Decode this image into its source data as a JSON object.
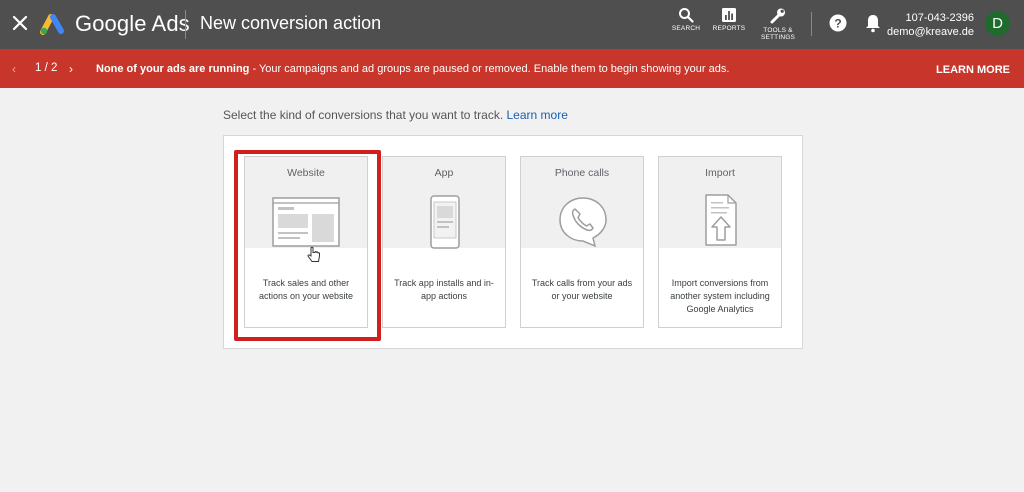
{
  "header": {
    "brand": "Google Ads",
    "title": "New conversion action",
    "tools": [
      {
        "label": "SEARCH",
        "icon": "search-icon"
      },
      {
        "label": "REPORTS",
        "icon": "reports-icon"
      },
      {
        "label_line1": "TOOLS &",
        "label_line2": "SETTINGS",
        "icon": "wrench-icon"
      }
    ],
    "account_id": "107-043-2396",
    "account_email": "demo@kreave.de",
    "avatar_letter": "D",
    "colors": {
      "bar": "#4f4f4f",
      "avatar": "#1e6b2c"
    }
  },
  "notice": {
    "pager": "1 / 2",
    "message_bold": "None of your ads are running",
    "message_rest": " - Your campaigns and ad groups are paused or removed. Enable them to begin showing your ads.",
    "action": "LEARN MORE",
    "color": "#c8352a"
  },
  "main": {
    "instruction": "Select the kind of conversions that you want to track.",
    "learn_more": "Learn more",
    "cards": [
      {
        "title": "Website",
        "description": "Track sales and other actions on your website",
        "icon": "website-icon",
        "selected": true
      },
      {
        "title": "App",
        "description": "Track app installs and in-app actions",
        "icon": "phone-app-icon"
      },
      {
        "title": "Phone calls",
        "description": "Track calls from your ads or your website",
        "icon": "phone-call-icon"
      },
      {
        "title": "Import",
        "description": "Import conversions from another system including Google Analytics",
        "icon": "import-icon"
      }
    ],
    "highlight_color": "#d11f1f"
  }
}
